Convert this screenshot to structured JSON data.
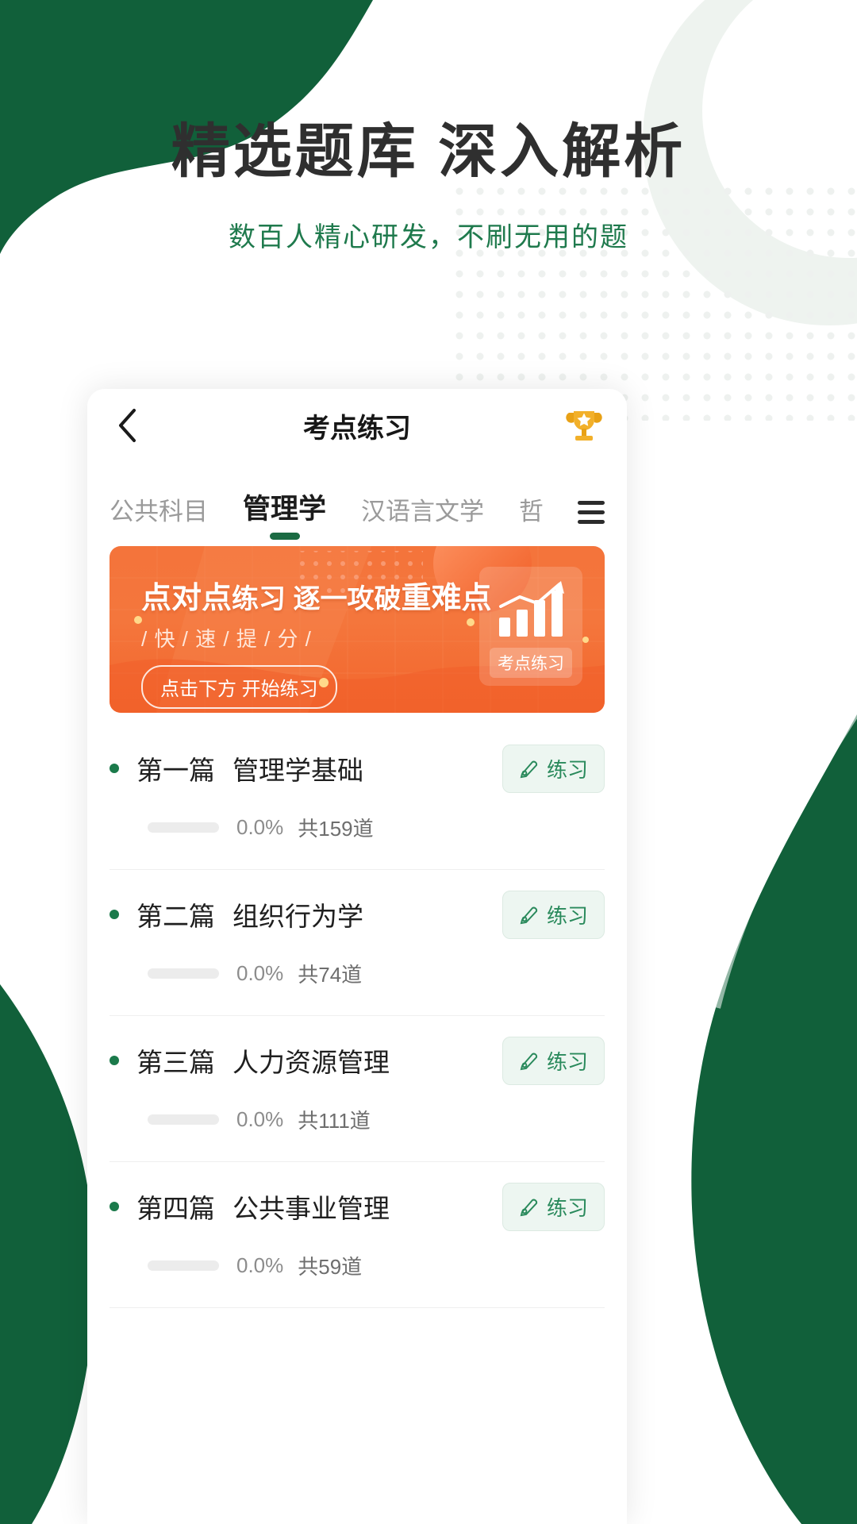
{
  "promo": {
    "title": "精选题库 深入解析",
    "subtitle": "数百人精心研发，不刷无用的题",
    "title_color": "#2f2f2f",
    "subtitle_color": "#1f7a4d"
  },
  "nav": {
    "back_icon": "chevron-left-icon",
    "title": "考点练习",
    "trophy_icon": "trophy-icon"
  },
  "tabs": {
    "items": [
      {
        "label": "公共科目",
        "active": false
      },
      {
        "label": "管理学",
        "active": true
      },
      {
        "label": "汉语言文学",
        "active": false
      },
      {
        "label": "哲",
        "active": false
      }
    ],
    "menu_icon": "hamburger-menu-icon",
    "active_indicator_color": "#1b6b43"
  },
  "banner": {
    "headline_bold_1": "点对点",
    "headline_light_1": "练习",
    "headline_light_2": " 逐一攻破",
    "headline_bold_2": "重难点",
    "sub": "/ 快 / 速 / 提 / 分 /",
    "button_label": "点击下方 开始练习",
    "chip_label": "考点练习",
    "chip_icon": "bar-chart-up-icon",
    "bg_color": "#f4743b"
  },
  "list": {
    "practice_label": "练习",
    "practice_icon": "pencil-edit-icon",
    "items": [
      {
        "chapter": "第一篇",
        "name": "管理学基础",
        "percent": "0.0%",
        "count": "共159道"
      },
      {
        "chapter": "第二篇",
        "name": "组织行为学",
        "percent": "0.0%",
        "count": "共74道"
      },
      {
        "chapter": "第三篇",
        "name": "人力资源管理",
        "percent": "0.0%",
        "count": "共111道"
      },
      {
        "chapter": "第四篇",
        "name": "公共事业管理",
        "percent": "0.0%",
        "count": "共59道"
      }
    ]
  },
  "theme": {
    "brand_green": "#1b6b43",
    "dark_green": "#11603a",
    "orange": "#f4743b",
    "mint": "#edf6f1"
  }
}
